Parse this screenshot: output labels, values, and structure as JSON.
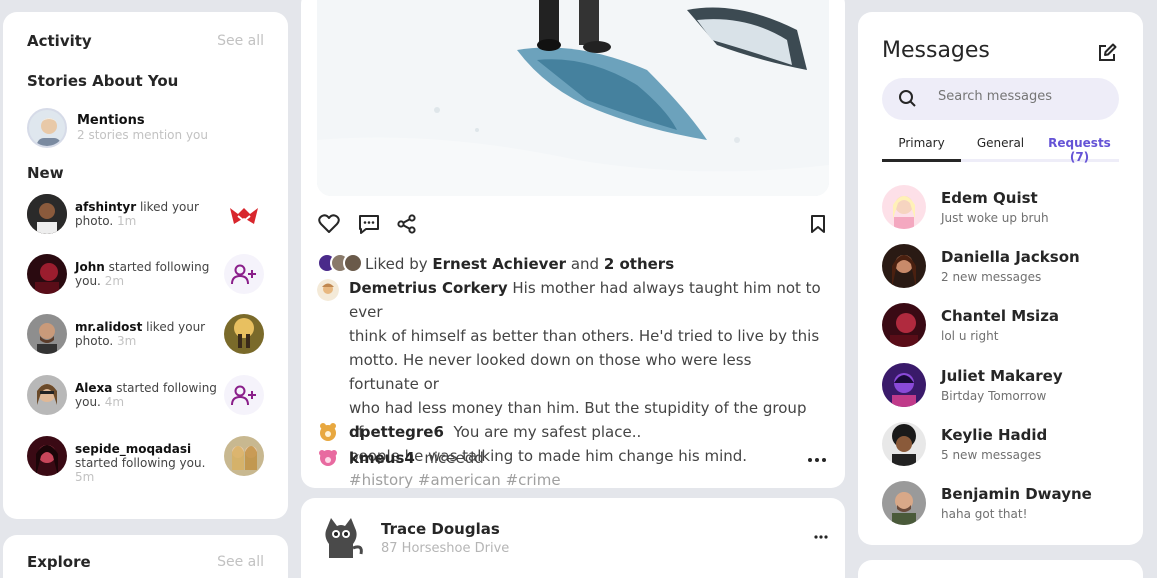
{
  "activity": {
    "title": "Activity",
    "see_all": "See all",
    "stories_title": "Stories About You",
    "mentions": {
      "name": "Mentions",
      "sub": "2 stories mention you"
    },
    "new_title": "New",
    "items": [
      {
        "user": "afshintyr",
        "action": " liked your photo.",
        "time": "1m",
        "thumb": "red-mask-image"
      },
      {
        "user": "John",
        "action": " started following you.",
        "time": "2m",
        "thumb": "add-user-icon"
      },
      {
        "user": "mr.alidost",
        "action": " liked your photo.",
        "time": "3m",
        "thumb": "field-photo"
      },
      {
        "user": "Alexa",
        "action": " started following you.",
        "time": "4m",
        "thumb": "add-user-icon"
      },
      {
        "user": "sepide_moqadasi",
        "action": " started following you.",
        "time": "5m",
        "thumb": "friends-photo"
      }
    ]
  },
  "explore": {
    "title": "Explore",
    "see_all": "See all"
  },
  "post": {
    "liked_prefix": "Liked by ",
    "liked_user": "Ernest Achiever",
    "liked_and": " and ",
    "liked_others": "2 others",
    "author": "Demetrius Corkery",
    "caption_lines": [
      " His mother had always taught him not to ever",
      "think of himself as better than others. He'd tried to live by this",
      "motto. He never looked down on those who were less fortunate or",
      "who had less money than him. But the stupidity of the group of",
      "people he was talking to made him change his mind."
    ],
    "hashtags": "#history #american #crime",
    "comments": [
      {
        "user": "dpettegre6",
        "text": "You are my safest place.."
      },
      {
        "user": "kmeus4",
        "text": "niceedd"
      }
    ]
  },
  "post2": {
    "author": "Trace Douglas",
    "location": "87 Horseshoe Drive"
  },
  "messages": {
    "title": "Messages",
    "search_placeholder": "Search messages",
    "tabs": [
      "Primary",
      "General",
      "Requests (7)"
    ],
    "items": [
      {
        "name": "Edem Quist",
        "sub": "Just woke up bruh"
      },
      {
        "name": "Daniella Jackson",
        "sub": "2 new messages"
      },
      {
        "name": "Chantel Msiza",
        "sub": "lol u right"
      },
      {
        "name": "Juliet Makarey",
        "sub": "Birtday Tomorrow"
      },
      {
        "name": "Keylie Hadid",
        "sub": "5 new messages"
      },
      {
        "name": "Benjamin Dwayne",
        "sub": "haha got that!"
      }
    ]
  },
  "colors": {
    "accent": "#5c4dd9",
    "requests": "#6553d6",
    "follow": "#8a1f8a",
    "search_bg": "#eeedf8"
  }
}
